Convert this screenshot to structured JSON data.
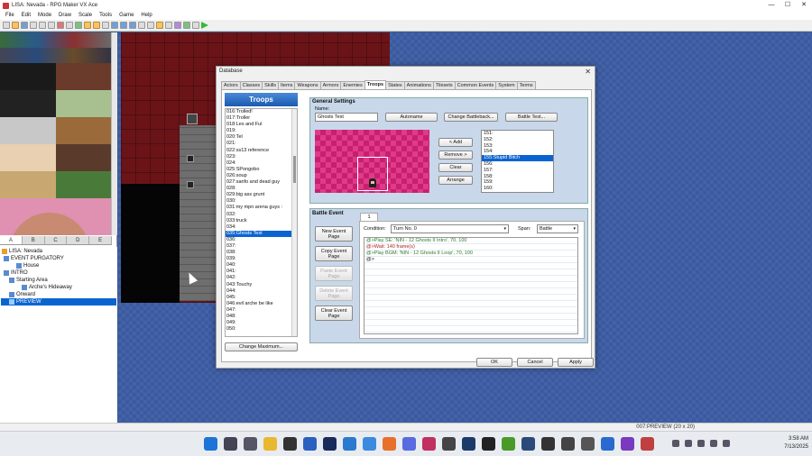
{
  "window": {
    "title": "LISA: Nevada - RPG Maker VX Ace",
    "min": "—",
    "max": "☐",
    "close": "✕"
  },
  "menu": [
    "File",
    "Edit",
    "Mode",
    "Draw",
    "Scale",
    "Tools",
    "Game",
    "Help"
  ],
  "map_tabs": [
    "A",
    "B",
    "C",
    "D",
    "E"
  ],
  "map_tree": [
    {
      "label": "LISA: Nevada",
      "level": 0
    },
    {
      "label": "EVENT PURGATORY",
      "level": 1
    },
    {
      "label": "House",
      "level": 2
    },
    {
      "label": "INTRO",
      "level": 1
    },
    {
      "label": "Starting Area",
      "level": 2
    },
    {
      "label": "Arche's Hideaway",
      "level": 3
    },
    {
      "label": "Onward",
      "level": 1
    },
    {
      "label": "PREVIEW",
      "level": 1,
      "selected": true
    }
  ],
  "dialog": {
    "title": "Database",
    "close": "✕",
    "tabs": [
      "Actors",
      "Classes",
      "Skills",
      "Items",
      "Weapons",
      "Armors",
      "Enemies",
      "Troops",
      "States",
      "Animations",
      "Tilesets",
      "Common Events",
      "System",
      "Terms"
    ],
    "selected_tab": "Troops",
    "list_header": "Troops",
    "troops": [
      "016:Trolled!",
      "017:Troller",
      "018:Les and Ful",
      "019:",
      "020:Tel",
      "021:",
      "022:ss13 reference",
      "023:",
      "024:",
      "025:SPongobo",
      "026:soup",
      "027:sanfo and dead guy",
      "028:",
      "029:big ass grunt",
      "030:",
      "031:my mpn arena guys :",
      "032:",
      "033:truck",
      "034:",
      "035:Ghosts Test",
      "036:",
      "037:",
      "038:",
      "039:",
      "040:",
      "041:",
      "042:",
      "043:Touchy",
      "044:",
      "045:",
      "046:evil arche be like",
      "047:",
      "048:",
      "049:",
      "050:"
    ],
    "selected_troop": "035:Ghosts Test",
    "change_maximum": "Change Maximum...",
    "general": {
      "header": "General Settings",
      "name_label": "Name:",
      "name_value": "Ghosts Test",
      "autoname": "Autoname",
      "change_battleback": "Change Battleback...",
      "battle_test": "Battle Test..."
    },
    "enemy_buttons": {
      "add": "< Add",
      "remove": "Remove >",
      "clear": "Clear",
      "arrange": "Arrange"
    },
    "enemies": [
      "151:",
      "152:",
      "153:",
      "154:",
      "155:Stupid Bitch",
      "156:",
      "157:",
      "158:",
      "159:",
      "160:"
    ],
    "selected_enemy": "155:Stupid Bitch",
    "battle_event": {
      "header": "Battle Event",
      "buttons": {
        "new": "New Event Page",
        "copy": "Copy Event Page",
        "paste": "Paste Event Page",
        "delete": "Delete Event Page",
        "clear": "Clear Event Page"
      },
      "page_tab": "1",
      "condition_label": "Condition:",
      "condition_value": "Turn No. 0",
      "span_label": "Span:",
      "span_value": "Battle",
      "commands": [
        {
          "text": "@>Play SE: 'NIN - 12 Ghosts II Intro', 70, 100",
          "type": "c1"
        },
        {
          "text": "@>Wait: 140 frame(s)",
          "type": "c2"
        },
        {
          "text": "@>Play BGM: 'NIN - 12 Ghosts II Loop', 70, 100",
          "type": "c1"
        },
        {
          "text": "@>",
          "type": "c3"
        }
      ]
    },
    "ok": "OK",
    "cancel": "Cancel",
    "apply": "Apply"
  },
  "status": {
    "map_info": "007:PREVIEW (20 x 20)"
  },
  "taskbar": {
    "time": "3:58 AM",
    "date": "7/13/2025"
  },
  "colors": {
    "selection": "#0a64d0",
    "panel": "#c8d8ea",
    "map_bg": "#3a5aa0"
  }
}
